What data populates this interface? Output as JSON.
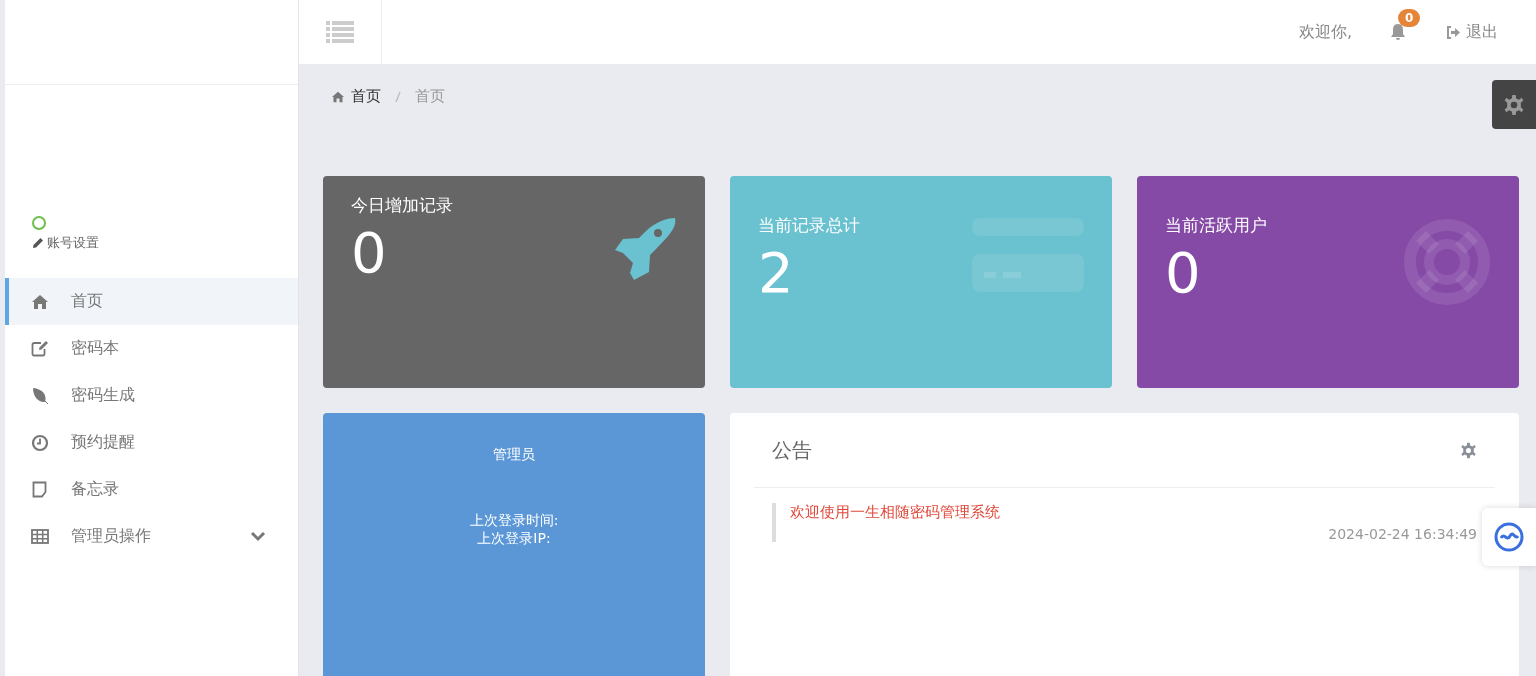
{
  "header": {
    "welcome": "欢迎你,",
    "notification_count": "0",
    "logout": "退出"
  },
  "sidebar": {
    "account_settings": "账号设置",
    "items": [
      {
        "label": "首页",
        "kind": "home",
        "selected": true
      },
      {
        "label": "密码本",
        "kind": "edit",
        "selected": false
      },
      {
        "label": "密码生成",
        "kind": "leaf",
        "selected": false
      },
      {
        "label": "预约提醒",
        "kind": "clock",
        "selected": false
      },
      {
        "label": "备忘录",
        "kind": "note",
        "selected": false
      },
      {
        "label": "管理员操作",
        "kind": "table",
        "selected": false,
        "expandable": true
      }
    ]
  },
  "breadcrumb": [
    "首页",
    "首页"
  ],
  "stats": [
    {
      "title": "今日增加记录",
      "value": "0",
      "kind": "rocket",
      "color": "#666666"
    },
    {
      "title": "当前记录总计",
      "value": "2",
      "kind": "card",
      "color": "#6ac1cf"
    },
    {
      "title": "当前活跃用户",
      "value": "0",
      "kind": "lifebuoy",
      "color": "#8549a6"
    }
  ],
  "admin_card": {
    "title": "管理员",
    "last_login_time": "上次登录时间:",
    "last_login_ip": "上次登录IP:"
  },
  "notice": {
    "title": "公告",
    "items": [
      {
        "text": "欢迎使用一生相随密码管理系统",
        "time": "2024-02-24 16:34:49"
      }
    ]
  }
}
